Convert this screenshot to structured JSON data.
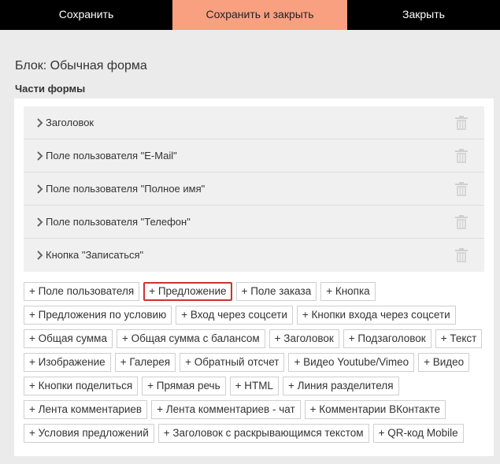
{
  "toolbar": {
    "save": "Сохранить",
    "save_close": "Сохранить и закрыть",
    "close": "Закрыть"
  },
  "block_title": "Блок: Обычная форма",
  "parts_label": "Части формы",
  "parts": [
    "Заголовок",
    "Поле пользователя \"E-Mail\"",
    "Поле пользователя \"Полное имя\"",
    "Поле пользователя \"Телефон\"",
    "Кнопка \"Записаться\""
  ],
  "add_buttons": [
    [
      "+ Поле пользователя",
      "+ Предложение",
      "+ Поле заказа",
      "+ Кнопка"
    ],
    [
      "+ Предложения по условию",
      "+ Вход через соцсети",
      "+ Кнопки входа через соцсети"
    ],
    [
      "+ Общая сумма",
      "+ Общая сумма с балансом",
      "+ Заголовок",
      "+ Подзаголовок",
      "+ Текст"
    ],
    [
      "+ Изображение",
      "+ Галерея",
      "+ Обратный отсчет",
      "+ Видео Youtube/Vimeo",
      "+ Видео"
    ],
    [
      "+ Кнопки поделиться",
      "+ Прямая речь",
      "+ HTML",
      "+ Линия разделителя"
    ],
    [
      "+ Лента комментариев",
      "+ Лента комментариев - чат",
      "+ Комментарии ВКонтакте"
    ],
    [
      "+ Условия предложений",
      "+ Заголовок с раскрывающимся текстом",
      "+ QR-код Mobile"
    ]
  ],
  "selected_add_button": "+ Предложение",
  "colors": {
    "toolbar_bg": "#000000",
    "accent": "#f9a081",
    "selected_border": "#d0312d"
  },
  "icons": {
    "part_expand": "chevron-right-icon",
    "part_delete": "trash-icon"
  }
}
